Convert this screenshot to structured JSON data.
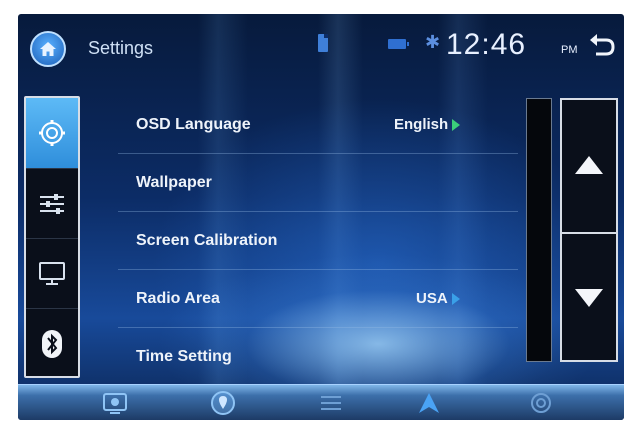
{
  "header": {
    "title": "Settings",
    "time": "12:46",
    "ampm": "PM",
    "icons": [
      "home-icon",
      "document-icon",
      "battery-icon",
      "bluetooth-icon",
      "back-icon"
    ]
  },
  "sidebar": {
    "items": [
      {
        "icon": "gear-icon",
        "active": true
      },
      {
        "icon": "equalizer-icon",
        "active": false
      },
      {
        "icon": "monitor-icon",
        "active": false
      },
      {
        "icon": "bluetooth-icon",
        "active": false
      }
    ]
  },
  "menu": {
    "items": [
      {
        "label": "OSD Language",
        "value": "English"
      },
      {
        "label": "Wallpaper",
        "value": ""
      },
      {
        "label": "Screen Calibration",
        "value": ""
      },
      {
        "label": "Radio Area",
        "value": "USA"
      },
      {
        "label": "Time Setting",
        "value": ""
      }
    ]
  },
  "scroll": {
    "icons": [
      "arrow-up-icon",
      "arrow-down-icon"
    ]
  },
  "bottombar": {
    "icons": [
      "media-icon",
      "navigation-pin-icon",
      "equalizer-icon",
      "navigate-arrow-icon",
      "settings-icon"
    ]
  },
  "colors": {
    "accent": "#3bb0f2",
    "value_arrow": "#3bd07a",
    "background": "#0c2c66"
  }
}
